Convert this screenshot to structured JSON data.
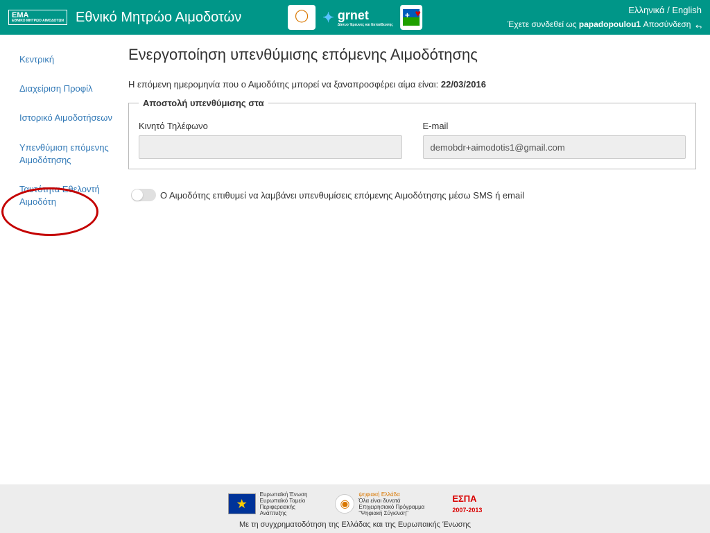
{
  "header": {
    "logoText": "EMA",
    "logoSub": "ΕΘΝΙΚΟ ΜΗΤΡΩΟ ΑΙΜΟΔΟΤΩΝ",
    "appTitle": "Εθνικό Μητρώο Αιμοδοτών",
    "partner1": "ε.κε.α.",
    "partner2": "grnet",
    "partner2Sub": "Δίκτυο Έρευνας και Εκπαίδευσης",
    "lang1": "Ελληνικά",
    "langSep": " / ",
    "lang2": "English",
    "loggedPrefix": "Έχετε συνδεθεί ως ",
    "username": "papadopoulou1",
    "logout": " Αποσύνδεση "
  },
  "sidebar": {
    "items": [
      {
        "label": "Κεντρική"
      },
      {
        "label": "Διαχείριση Προφίλ"
      },
      {
        "label": "Ιστορικό Αιμοδοτήσεων"
      },
      {
        "label": "Υπενθύμιση επόμενης Αιμοδότησης"
      },
      {
        "label": "Ταυτότητα Εθελοντή Αιμοδότη"
      }
    ]
  },
  "main": {
    "title": "Ενεργοποίηση υπενθύμισης επόμενης Αιμοδότησης",
    "infoPrefix": "Η επόμενη ημερομηνία που ο Αιμοδότης μπορεί να ξαναπροσφέρει αίμα είναι: ",
    "nextDate": "22/03/2016",
    "legend": "Αποστολή υπενθύμισης στα",
    "phoneLabel": "Κινητό Τηλέφωνο",
    "phoneValue": "",
    "emailLabel": "E-mail",
    "emailValue": "demobdr+aimodotis1@gmail.com",
    "toggleLabel": "Ο Αιμοδότης επιθυμεί να λαμβάνει υπενθυμίσεις επόμενης Αιμοδότησης μέσω SMS ή email"
  },
  "footer": {
    "eu1": "Ευρωπαϊκή Ένωση",
    "eu2": "Ευρωπαϊκό Ταμείο",
    "eu3": "Περιφερειακής",
    "eu4": "Ανάπτυξης",
    "dg1": "ψηφιακή Ελλάδα",
    "dg2": "Όλα είναι δυνατά",
    "dg3": "Επιχειρησιακό Πρόγραμμα",
    "dg4": "\"Ψηφιακή Σύγκλιση\"",
    "espa1": "ΕΣΠΑ",
    "espa2": "2007-2013",
    "cofin": "Με τη συγχρηματοδότηση της Ελλάδας και της Ευρωπαικής Ένωσης"
  }
}
